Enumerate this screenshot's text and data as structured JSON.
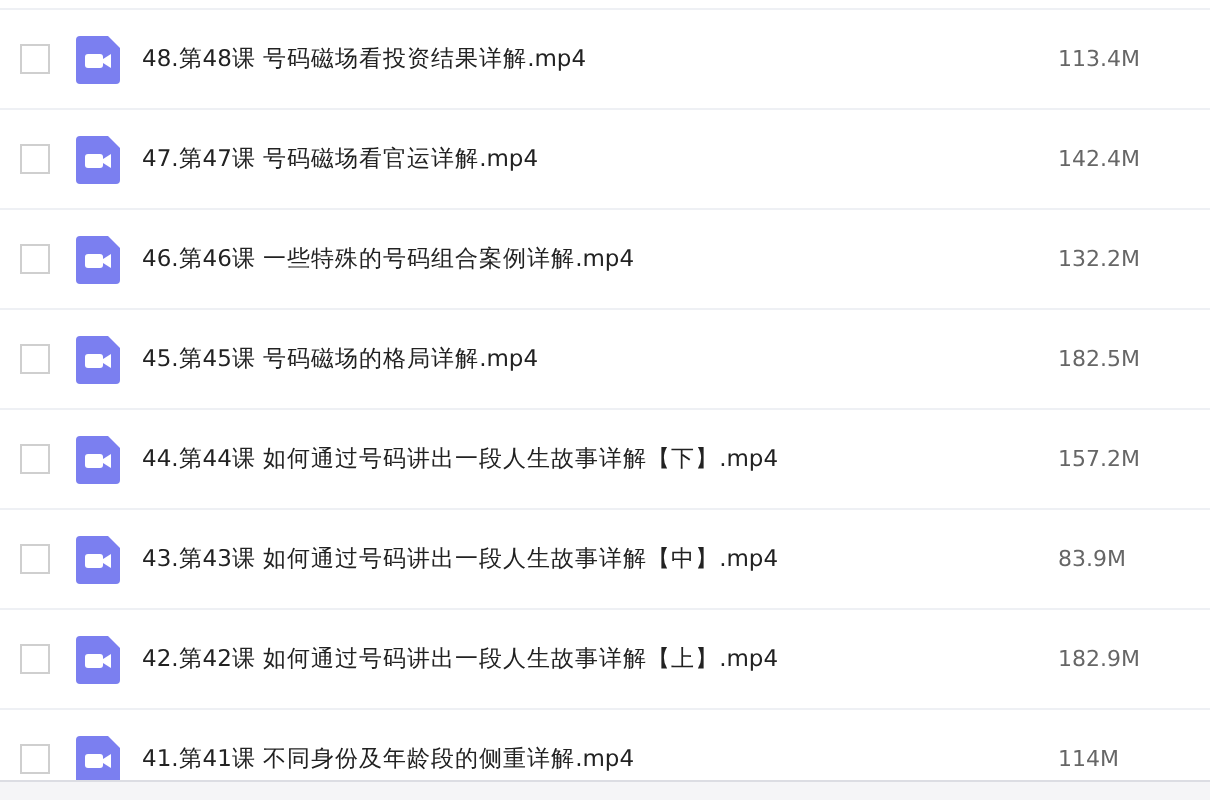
{
  "files": [
    {
      "name": "48.第48课 号码磁场看投资结果详解.mp4",
      "size": "113.4M",
      "checked": false
    },
    {
      "name": "47.第47课 号码磁场看官运详解.mp4",
      "size": "142.4M",
      "checked": false
    },
    {
      "name": "46.第46课 一些特殊的号码组合案例详解.mp4",
      "size": "132.2M",
      "checked": false
    },
    {
      "name": "45.第45课 号码磁场的格局详解.mp4",
      "size": "182.5M",
      "checked": false
    },
    {
      "name": "44.第44课 如何通过号码讲出一段人生故事详解【下】.mp4",
      "size": "157.2M",
      "checked": false
    },
    {
      "name": "43.第43课 如何通过号码讲出一段人生故事详解【中】.mp4",
      "size": "83.9M",
      "checked": false
    },
    {
      "name": "42.第42课 如何通过号码讲出一段人生故事详解【上】.mp4",
      "size": "182.9M",
      "checked": false
    },
    {
      "name": "41.第41课 不同身份及年龄段的侧重详解.mp4",
      "size": "114M",
      "checked": false
    }
  ]
}
